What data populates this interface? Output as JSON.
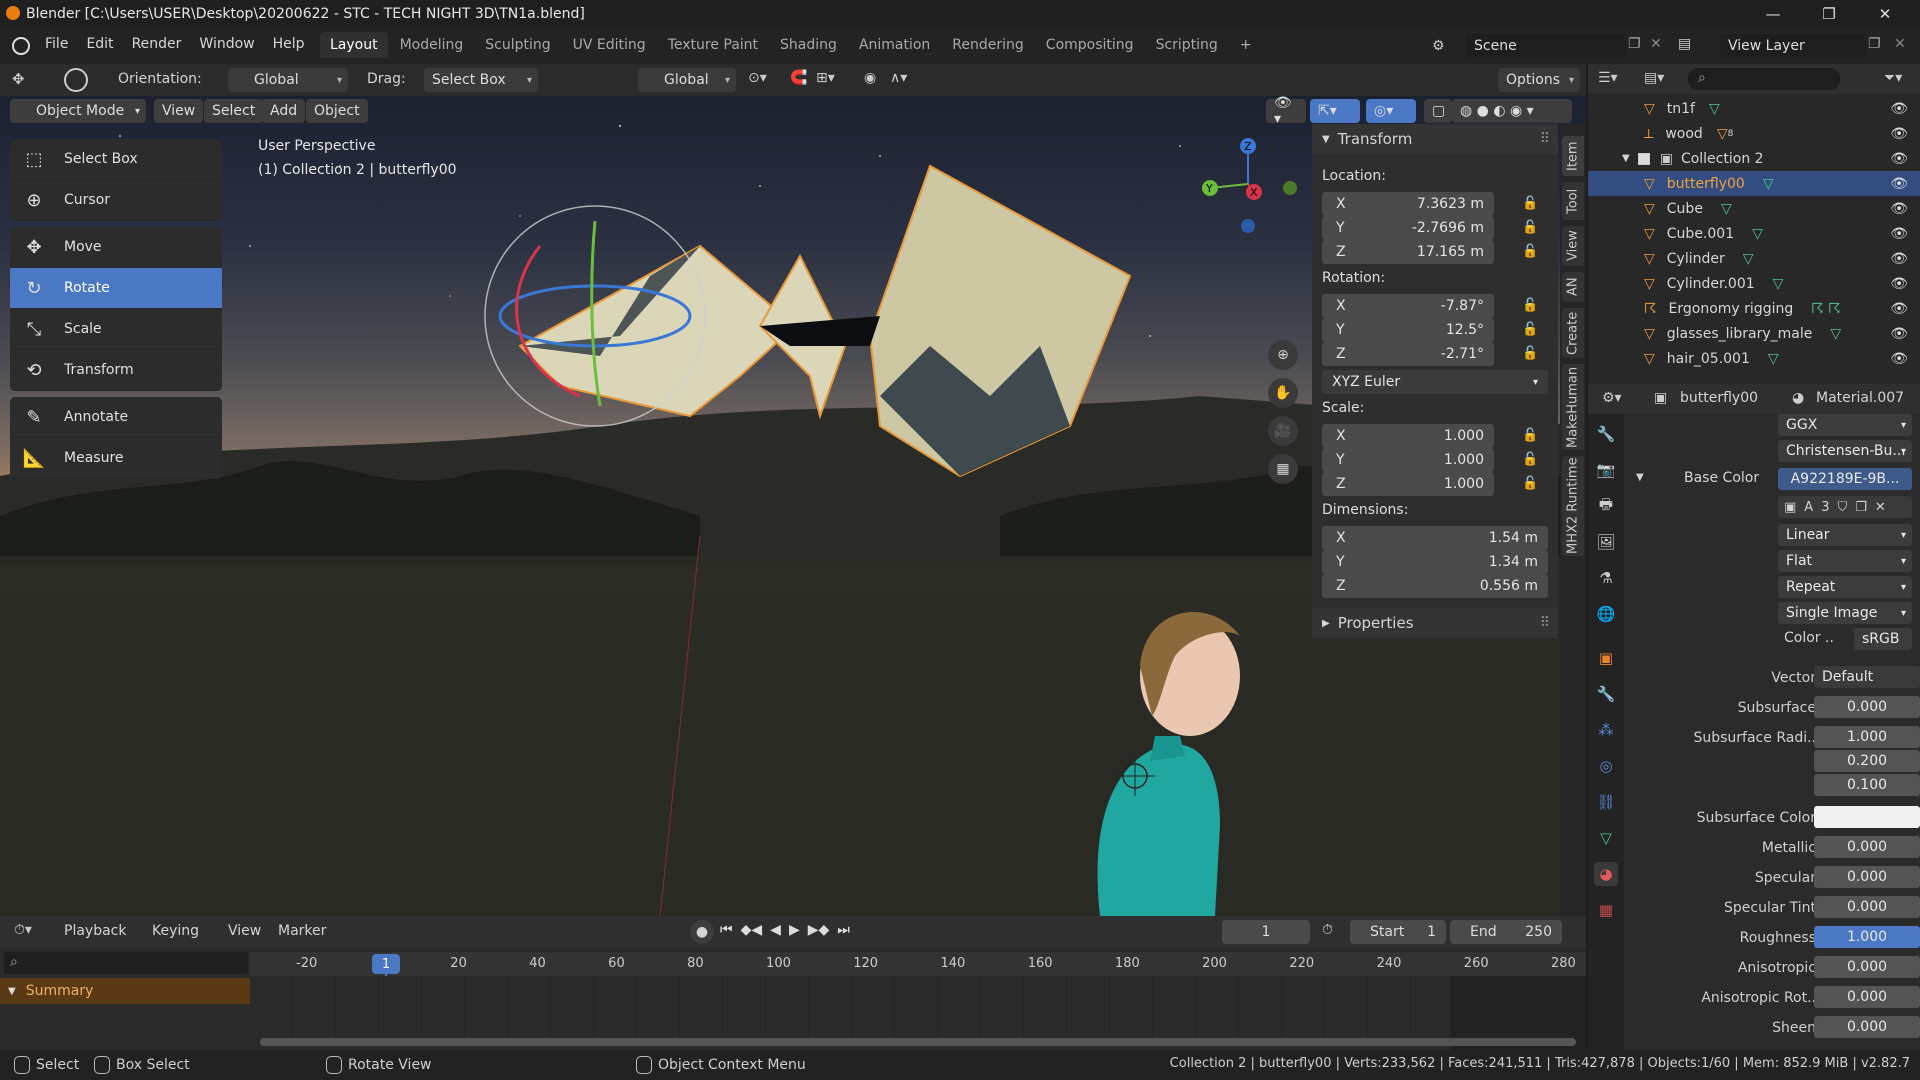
{
  "window": {
    "title": "Blender [C:\\Users\\USER\\Desktop\\20200622 - STC - TECH NIGHT 3D\\TN1a.blend]"
  },
  "menu": {
    "items": [
      "File",
      "Edit",
      "Render",
      "Window",
      "Help"
    ],
    "workspaces": [
      "Layout",
      "Modeling",
      "Sculpting",
      "UV Editing",
      "Texture Paint",
      "Shading",
      "Animation",
      "Rendering",
      "Compositing",
      "Scripting"
    ],
    "add_tab": "+",
    "scene": "Scene",
    "view_layer": "View Layer"
  },
  "tool_header": {
    "orientation_label": "Orientation:",
    "orientation_value": "Global",
    "drag_label": "Drag:",
    "drag_value": "Select Box",
    "transform_orientation": "Global",
    "options": "Options"
  },
  "viewport_header": {
    "mode": "Object Mode",
    "menus": [
      "View",
      "Select",
      "Add",
      "Object"
    ]
  },
  "viewport": {
    "perspective": "User Perspective",
    "collection_info": "(1) Collection 2 | butterfly00",
    "gizmo": {
      "z": "Z",
      "y": "Y",
      "x": "X"
    }
  },
  "toolbar": {
    "tools": [
      "Select Box",
      "Cursor",
      "Move",
      "Rotate",
      "Scale",
      "Transform",
      "Annotate",
      "Measure"
    ],
    "active": "Rotate"
  },
  "npanel": {
    "transform_header": "Transform",
    "location_label": "Location:",
    "location": [
      {
        "axis": "X",
        "value": "7.3623 m"
      },
      {
        "axis": "Y",
        "value": "-2.7696 m"
      },
      {
        "axis": "Z",
        "value": "17.165 m"
      }
    ],
    "rotation_label": "Rotation:",
    "rotation": [
      {
        "axis": "X",
        "value": "-7.87°"
      },
      {
        "axis": "Y",
        "value": "12.5°"
      },
      {
        "axis": "Z",
        "value": "-2.71°"
      }
    ],
    "rotation_mode": "XYZ Euler",
    "scale_label": "Scale:",
    "scale": [
      {
        "axis": "X",
        "value": "1.000"
      },
      {
        "axis": "Y",
        "value": "1.000"
      },
      {
        "axis": "Z",
        "value": "1.000"
      }
    ],
    "dimensions_label": "Dimensions:",
    "dimensions": [
      {
        "axis": "X",
        "value": "1.54 m"
      },
      {
        "axis": "Y",
        "value": "1.34 m"
      },
      {
        "axis": "Z",
        "value": "0.556 m"
      }
    ],
    "properties_header": "Properties",
    "tabs": [
      "Item",
      "Tool",
      "View",
      "AN",
      "Create",
      "MakeHuman",
      "MHX2 Runtime"
    ]
  },
  "outliner": {
    "rows": [
      {
        "name": "tn1f",
        "selected": false
      },
      {
        "name": "wood",
        "selected": false
      },
      {
        "name": "Collection 2",
        "selected": false
      },
      {
        "name": "butterfly00",
        "selected": true
      },
      {
        "name": "Cube",
        "selected": false
      },
      {
        "name": "Cube.001",
        "selected": false
      },
      {
        "name": "Cylinder",
        "selected": false
      },
      {
        "name": "Cylinder.001",
        "selected": false
      },
      {
        "name": "Ergonomy rigging",
        "selected": false
      },
      {
        "name": "glasses_library_male",
        "selected": false
      },
      {
        "name": "hair_05.001",
        "selected": false
      }
    ],
    "wood_badge": "8"
  },
  "properties": {
    "object": "butterfly00",
    "material": "Material.007",
    "distribution": "GGX",
    "subsurface_method": "Christensen-Bu...",
    "base_color_label": "Base Color",
    "base_color_value": "A922189E-9B...",
    "image_users": "3",
    "image_a": "A",
    "interpolation": "Linear",
    "projection": "Flat",
    "extension": "Repeat",
    "source": "Single Image",
    "color_label": "Color ..",
    "color_space": "sRGB",
    "rows": [
      {
        "label": "Vector",
        "value": "Default",
        "kind": "dd"
      },
      {
        "label": "Subsurface",
        "value": "0.000",
        "kind": "num"
      },
      {
        "label": "Subsurface Radi..",
        "value": "1.000",
        "kind": "num"
      },
      {
        "label": "",
        "value": "0.200",
        "kind": "num"
      },
      {
        "label": "",
        "value": "0.100",
        "kind": "num"
      },
      {
        "label": "Subsurface Color",
        "value": "",
        "kind": "color"
      },
      {
        "label": "Metallic",
        "value": "0.000",
        "kind": "num"
      },
      {
        "label": "Specular",
        "value": "0.000",
        "kind": "num"
      },
      {
        "label": "Specular Tint",
        "value": "0.000",
        "kind": "num"
      },
      {
        "label": "Roughness",
        "value": "1.000",
        "kind": "blue"
      },
      {
        "label": "Anisotropic",
        "value": "0.000",
        "kind": "num"
      },
      {
        "label": "Anisotropic Rot..",
        "value": "0.000",
        "kind": "num"
      },
      {
        "label": "Sheen",
        "value": "0.000",
        "kind": "num"
      }
    ]
  },
  "timeline": {
    "menus": [
      "Playback",
      "Keying",
      "View",
      "Marker"
    ],
    "current_frame": "1",
    "start_label": "Start",
    "start": "1",
    "end_label": "End",
    "end": "250",
    "ruler": [
      "-20",
      "20",
      "40",
      "60",
      "80",
      "100",
      "120",
      "140",
      "160",
      "180",
      "200",
      "220",
      "240",
      "260",
      "280"
    ],
    "playhead": "1",
    "summary": "Summary"
  },
  "statusbar": {
    "select": "Select",
    "box_select": "Box Select",
    "rotate_view": "Rotate View",
    "context_menu": "Object Context Menu",
    "stats": "Collection 2 | butterfly00 | Verts:233,562 | Faces:241,511 | Tris:427,878 | Objects:1/60 | Mem: 852.9 MiB | v2.82.7"
  },
  "colors": {
    "accent": "#4a78c4",
    "selected_text": "#f0a040",
    "active_tab": "#303030"
  }
}
